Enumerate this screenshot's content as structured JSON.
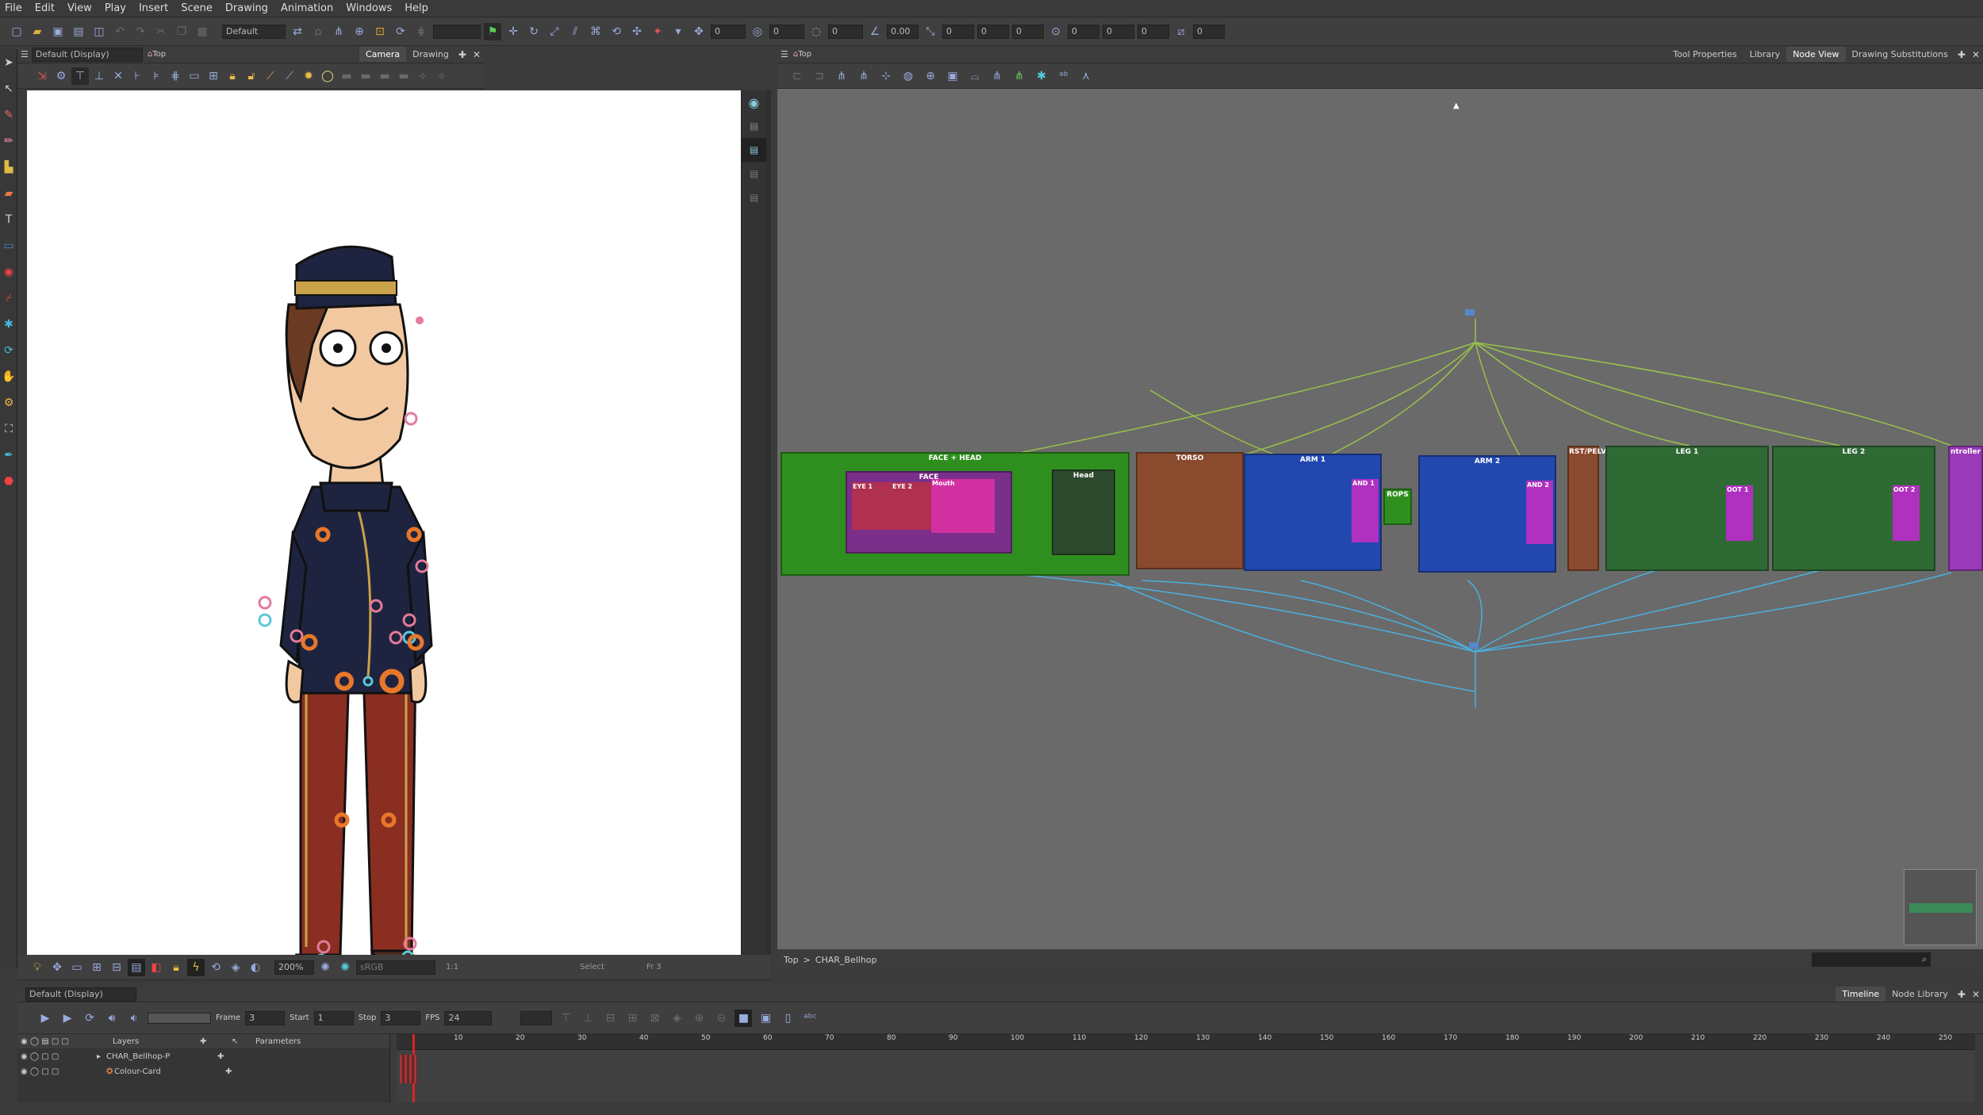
{
  "menu": [
    "File",
    "Edit",
    "View",
    "Play",
    "Insert",
    "Scene",
    "Drawing",
    "Animation",
    "Windows",
    "Help"
  ],
  "toolbar": {
    "workspace": "Default",
    "numbers": [
      "0",
      "0",
      "0",
      "0.00",
      "0",
      "0",
      "0",
      "0",
      "0",
      "0",
      "0"
    ]
  },
  "camera": {
    "display": "Default (Display)",
    "breadcrumb": "Top",
    "tabs": [
      "Camera",
      "Drawing"
    ],
    "zoom": "200%",
    "colorspace": "sRGB",
    "ratio": "1:1",
    "status_tool": "Select",
    "status_frame": "Fr 3"
  },
  "nodeview": {
    "breadcrumb": "Top",
    "tabs": [
      "Tool Properties",
      "Library",
      "Node View",
      "Drawing Substitutions"
    ],
    "path_root": "Top",
    "path_sep": ">",
    "path_node": "CHAR_Bellhop",
    "groups": [
      {
        "label": "FACE + HEAD",
        "color": "#2f8f1e"
      },
      {
        "label": "TORSO",
        "color": "#8a4a2e"
      },
      {
        "label": "ARM 1",
        "color": "#2248b0"
      },
      {
        "label": "ARM 2",
        "color": "#2248b0"
      },
      {
        "label": "RST/PELV",
        "color": "#8a4a2e"
      },
      {
        "label": "LEG 1",
        "color": "#2f6a35"
      },
      {
        "label": "LEG 2",
        "color": "#2f6a35"
      },
      {
        "label": "ntroller",
        "color": "#9a3ab8"
      }
    ],
    "subnodes": {
      "face": "FACE",
      "eye1": "EYE 1",
      "eye2": "EYE 2",
      "mouth": "Mouth",
      "head": "Head",
      "props": "ROPS",
      "foot1": "OOT 1",
      "foot2": "OOT 2",
      "hand1": "AND 1",
      "hand2": "AND 2"
    }
  },
  "timeline": {
    "display": "Default (Display)",
    "frame_label": "Frame",
    "frame": "3",
    "start_label": "Start",
    "start": "1",
    "stop_label": "Stop",
    "stop": "3",
    "fps_label": "FPS",
    "fps": "24",
    "tabs": [
      "Timeline",
      "Node Library"
    ],
    "layers_header": "Layers",
    "params_header": "Parameters",
    "layers": [
      "CHAR_Bellhop-P",
      "Colour-Card"
    ],
    "ticks": [
      "10",
      "20",
      "30",
      "40",
      "50",
      "60",
      "70",
      "80",
      "90",
      "100",
      "110",
      "120",
      "130",
      "140",
      "150",
      "160",
      "170",
      "180",
      "190",
      "200",
      "210",
      "220",
      "230",
      "240",
      "250"
    ]
  }
}
